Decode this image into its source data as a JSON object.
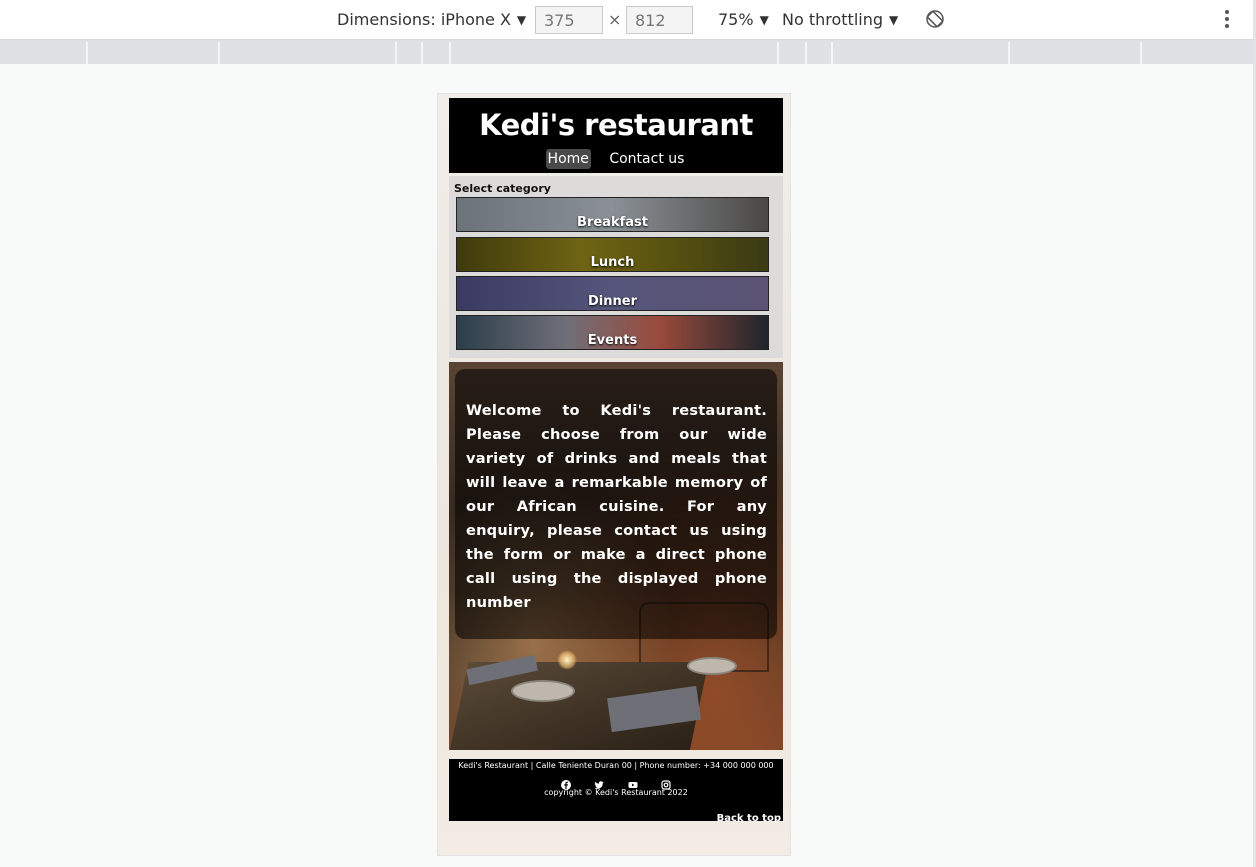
{
  "devtools": {
    "device_label": "Dimensions: iPhone X",
    "width_value": "375",
    "height_value": "812",
    "times": "×",
    "zoom": "75%",
    "throttle": "No throttling"
  },
  "site": {
    "title": "Kedi's restaurant",
    "nav": [
      "Home",
      "Contact us"
    ],
    "active_nav": "Home"
  },
  "categories": {
    "label": "Select category",
    "items": [
      "Breakfast",
      "Lunch",
      "Dinner",
      "Events"
    ]
  },
  "welcome": {
    "text": "Welcome to Kedi's restaurant. Please choose from our wide variety of drinks and meals that will leave a remarkable memory of our African cuisine. For any enquiry, please contact us using the form or make a direct phone call using the displayed phone number"
  },
  "footer": {
    "info": "Kedi's Restaurant | Calle Teniente Duran 00 | Phone number: +34 000 000 000",
    "socials": [
      "facebook-icon",
      "twitter-icon",
      "youtube-icon",
      "instagram-icon"
    ],
    "copyright": "copyright © Kedi's Restaurant 2022",
    "back_to_top": "Back to top"
  }
}
